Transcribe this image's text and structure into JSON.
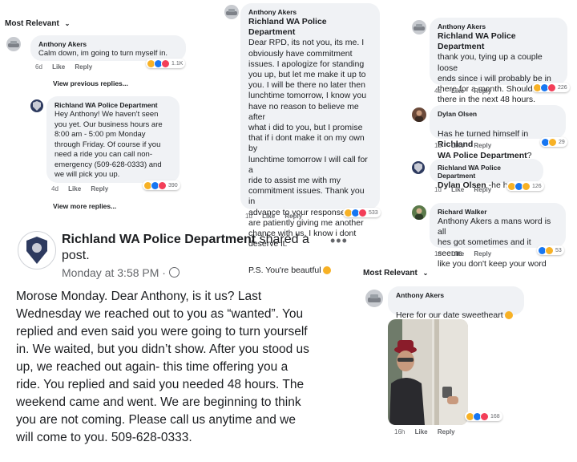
{
  "panel1": {
    "sort_label": "Most Relevant",
    "comment1": {
      "name": "Anthony Akers",
      "text": "Calm down, im going to turn myself in.",
      "time": "6d",
      "like": "Like",
      "reply": "Reply",
      "reactions": "1.1K"
    },
    "view_previous": "View previous replies...",
    "comment2": {
      "name": "Richland WA Police Department",
      "text": "Hey Anthony! We haven't seen\nyou yet. Our business hours are\n8:00 am - 5:00 pm Monday\nthrough Friday. Of course if you\nneed a ride you can call non-\nemergency (509-628-0333) and\nwe will pick you up.",
      "time": "4d",
      "like": "Like",
      "reply": "Reply",
      "reactions": "390"
    },
    "view_more": "View more replies..."
  },
  "panel2": {
    "name": "Anthony Akers",
    "recipient": "Richland WA Police Department",
    "text": "Dear RPD, its not you, its me. I\nobviously have commitment\nissues. I apologize for standing\nyou up, but let me make it up to\nyou. I will be there no later then\nlunchtime tomorrow, I know you\nhave no reason to believe me after\nwhat i did to you, but I promise\nthat if i dont make it on my own by\nlunchtime tomorrow I will call for a\nride to assist me with my\ncommitment issues. Thank you in\nadvance to your response if you\nare patiently giving me another\nchance with us, I know i dont\ndeserve it.",
    "ps": "P.S. You're beautful",
    "time": "1d",
    "like": "Like",
    "reply": "Reply",
    "reactions": "533"
  },
  "panel3": {
    "c1": {
      "name": "Anthony Akers",
      "tag": "Richland WA Police Department",
      "text": "thank you, tying up a couple loose\nends since i will probably be in\nthere for a month. Should be in\nthere in the next 48 hours.",
      "time": "4d",
      "like": "Like",
      "reply": "Reply",
      "reactions": "226"
    },
    "c2": {
      "name": "Dylan Olsen",
      "text": "Has he turned himself in",
      "tag": "Richland\nWA Police Department",
      "text_end": "?",
      "time": "1d",
      "like": "Like",
      "reply": "Reply",
      "reactions": "29"
    },
    "c3": {
      "name": "Richland WA Police Department",
      "tag": "Dylan Olsen",
      "text": " -he has not.",
      "time": "1d",
      "like": "Like",
      "reply": "Reply",
      "reactions": "126"
    },
    "c4": {
      "name": "Richard Walker",
      "text": "Anthony Akers a mans word is all\nhes got sometimes and it seems\nlike you don't keep your word",
      "time": "1d",
      "like": "Like",
      "reply": "Reply",
      "reactions": "53"
    }
  },
  "post": {
    "author": "Richland WA Police Department",
    "action": "shared a",
    "action2": "post.",
    "time": "Monday at 3:58 PM",
    "separator": "·",
    "body": "Morose Monday. Dear Anthony, is it us? Last\nWednesday we reached out to you as “wanted”. You\nreplied and even said you were going to turn yourself\nin. We waited, but you didn’t show. After you stood us\nup, we reached out again- this time offering you a\nride. You replied and said you needed 48 hours. The\nweekend came and went. We are beginning to think\nyou are not coming.  Please call us anytime and we\nwill come to you. 509-628-0333."
  },
  "panel4": {
    "sort_label": "Most Relevant",
    "name": "Anthony Akers",
    "text": "Here for our date sweetheart",
    "time": "16h",
    "like": "Like",
    "reply": "Reply",
    "reactions": "168"
  },
  "colors": {
    "link": "#1877f2",
    "bubble": "#f0f2f5",
    "meta": "#65676b"
  }
}
